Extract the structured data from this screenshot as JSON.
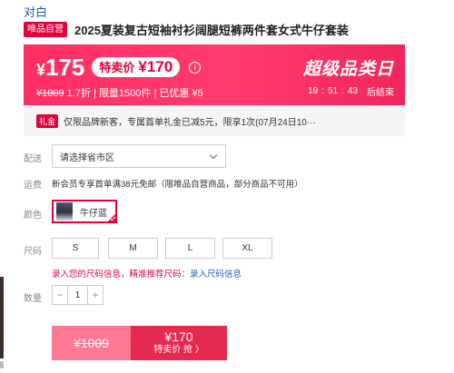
{
  "breadcrumb": "对白",
  "product": {
    "tag": "唯品自营",
    "title": "2025夏装复古短袖衬衫阔腿短裤两件套女式牛仔套装"
  },
  "price_banner": {
    "currency": "¥",
    "price": "175",
    "special_label": "特卖价",
    "special_price": "¥170",
    "info_icon": "ⓘ",
    "original_price": "¥1009",
    "discount": "1.7折",
    "limit": "限量1500件",
    "sold": "已优惠 ¥5",
    "separator": "|",
    "promo_title": "超级品类日",
    "countdown": {
      "h": "19",
      "m": "51",
      "s": "43",
      "label": "后结束"
    },
    "colors": {
      "accent": "#ff2e63",
      "brand": "#e5003a"
    }
  },
  "coupon": {
    "tag": "礼金",
    "text": "仅限品牌新客，专属首单礼金已减5元，限享1次(07月24日10···"
  },
  "labels": {
    "delivery": "配送",
    "shipping": "运费",
    "color": "颜色",
    "size": "尺码",
    "quantity": "数量"
  },
  "delivery": {
    "value": "请选择省市区"
  },
  "shipping": {
    "text": "新会员专享首单满38元免邮（限唯品自营商品，部分商品不可用）"
  },
  "color_option": {
    "name": "牛仔蓝"
  },
  "sizes": [
    "S",
    "M",
    "L",
    "XL"
  ],
  "size_hint": {
    "prefix": "录入您的尺码信息，精准推荐尺码：",
    "link": "录入尺码信息"
  },
  "quantity": {
    "minus": "−",
    "value": "1",
    "plus": "+"
  },
  "buy": {
    "original_price": "¥1009",
    "special_price": "¥170",
    "action": "特卖价 抢 〉"
  }
}
